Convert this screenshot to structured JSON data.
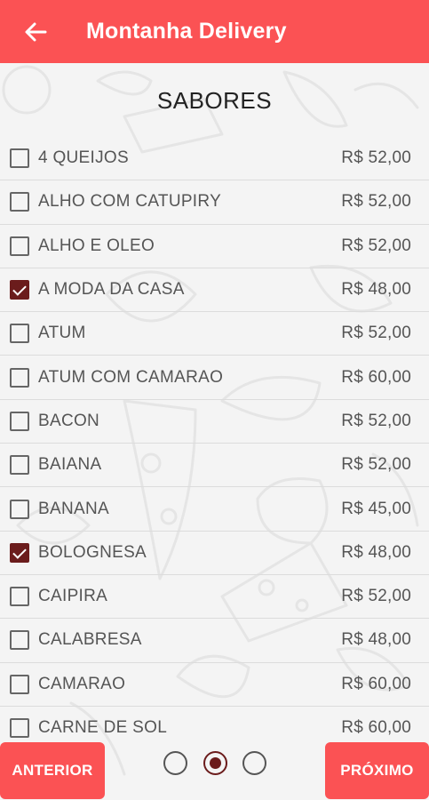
{
  "appbar": {
    "title": "Montanha Delivery",
    "back_icon": "arrow-left-icon",
    "color": "#fb5254"
  },
  "section": {
    "title": "SABORES"
  },
  "flavors": [
    {
      "name": "4 QUEIJOS",
      "price": "R$ 52,00",
      "checked": false
    },
    {
      "name": "ALHO COM CATUPIRY",
      "price": "R$ 52,00",
      "checked": false
    },
    {
      "name": "ALHO E OLEO",
      "price": "R$ 52,00",
      "checked": false
    },
    {
      "name": "A MODA DA CASA",
      "price": "R$ 48,00",
      "checked": true
    },
    {
      "name": "ATUM",
      "price": "R$ 52,00",
      "checked": false
    },
    {
      "name": "ATUM COM CAMARAO",
      "price": "R$ 60,00",
      "checked": false
    },
    {
      "name": "BACON",
      "price": "R$ 52,00",
      "checked": false
    },
    {
      "name": "BAIANA",
      "price": "R$ 52,00",
      "checked": false
    },
    {
      "name": "BANANA",
      "price": "R$ 45,00",
      "checked": false
    },
    {
      "name": "BOLOGNESA",
      "price": "R$ 48,00",
      "checked": true
    },
    {
      "name": "CAIPIRA",
      "price": "R$ 52,00",
      "checked": false
    },
    {
      "name": "CALABRESA",
      "price": "R$ 48,00",
      "checked": false
    },
    {
      "name": "CAMARAO",
      "price": "R$ 60,00",
      "checked": false
    },
    {
      "name": "CARNE DE SOL",
      "price": "R$ 60,00",
      "checked": false
    }
  ],
  "footer": {
    "prev_label": "ANTERIOR",
    "next_label": "PRÓXIMO",
    "steps": [
      {
        "active": false
      },
      {
        "active": true
      },
      {
        "active": false
      }
    ]
  },
  "colors": {
    "accent": "#fb5254",
    "checked": "#6b1c1c"
  }
}
